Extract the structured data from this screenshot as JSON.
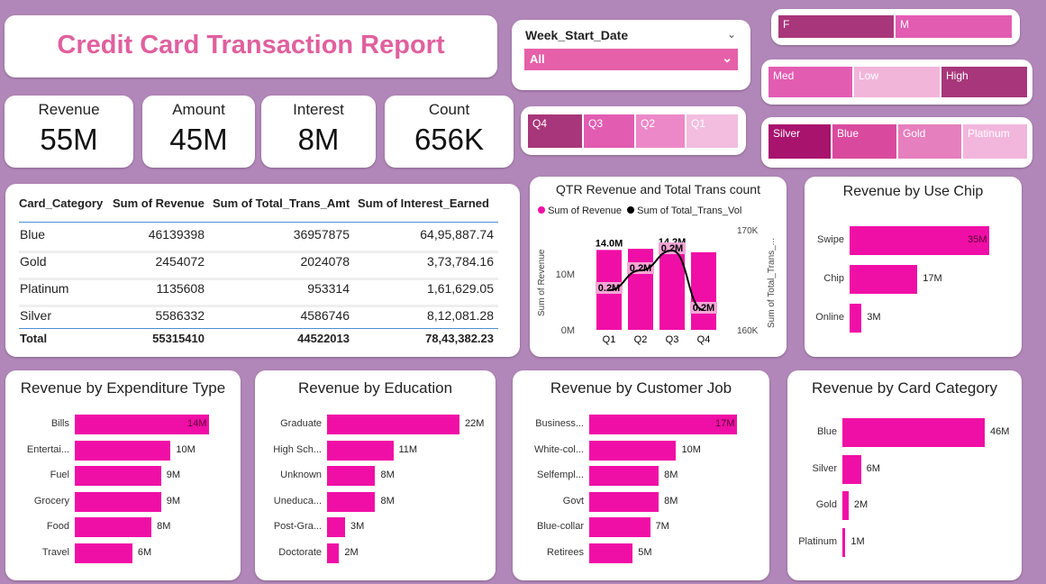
{
  "report_title": "Credit Card Transaction Report",
  "kpis": [
    {
      "label": "Revenue",
      "value": "55M"
    },
    {
      "label": "Amount",
      "value": "45M"
    },
    {
      "label": "Interest",
      "value": "8M"
    },
    {
      "label": "Count",
      "value": "656K"
    }
  ],
  "week_slicer": {
    "label": "Week_Start_Date",
    "selected": "All"
  },
  "gender_slicer": [
    "F",
    "M"
  ],
  "income_slicer": [
    "Med",
    "Low",
    "High"
  ],
  "quarter_slicer": [
    "Q4",
    "Q3",
    "Q2",
    "Q1"
  ],
  "card_slicer": [
    "Silver",
    "Blue",
    "Gold",
    "Platinum"
  ],
  "colors": {
    "accent": "#e0609e",
    "bar": "#f00fa6",
    "background": "#b186b8"
  },
  "table": {
    "headers": [
      "Card_Category",
      "Sum of Revenue",
      "Sum of Total_Trans_Amt",
      "Sum of Interest_Earned"
    ],
    "rows": [
      [
        "Blue",
        "46139398",
        "36957875",
        "64,95,887.74"
      ],
      [
        "Gold",
        "2454072",
        "2024078",
        "3,73,784.16"
      ],
      [
        "Platinum",
        "1135608",
        "953314",
        "1,61,629.05"
      ],
      [
        "Silver",
        "5586332",
        "4586746",
        "8,12,081.28"
      ]
    ],
    "total": [
      "Total",
      "55315410",
      "44522013",
      "78,43,382.23"
    ]
  },
  "qtr_chart": {
    "title": "QTR Revenue and Total Trans count",
    "legend": [
      "Sum of Revenue",
      "Sum of Total_Trans_Vol"
    ],
    "y_left_label": "Sum of Revenue",
    "y_right_label": "Sum of Total_Trans_...",
    "y_left_ticks": [
      "10M",
      "0M"
    ],
    "y_right_ticks": [
      "170K",
      "160K"
    ]
  },
  "chart_data": [
    {
      "type": "bar",
      "title": "QTR Revenue and Total Trans count",
      "categories": [
        "Q1",
        "Q2",
        "Q3",
        "Q4"
      ],
      "series": [
        {
          "name": "Sum of Revenue",
          "values": [
            14.0,
            14.2,
            14.2,
            13.6
          ],
          "labels": [
            "14.0M",
            "",
            "14.2M",
            ""
          ]
        },
        {
          "name": "Sum of Total_Trans_Vol",
          "values": [
            0.164,
            0.166,
            0.168,
            0.162
          ],
          "labels": [
            "0.2M",
            "0.2M",
            "0.2M",
            "0.2M"
          ]
        }
      ],
      "ylim": [
        0,
        15
      ]
    },
    {
      "type": "bar",
      "title": "Revenue by Use Chip",
      "categories": [
        "Swipe",
        "Chip",
        "Online"
      ],
      "values": [
        35,
        17,
        3
      ],
      "labels": [
        "35M",
        "17M",
        "3M"
      ]
    },
    {
      "type": "bar",
      "title": "Revenue by Expenditure Type",
      "categories": [
        "Bills",
        "Entertai...",
        "Fuel",
        "Grocery",
        "Food",
        "Travel"
      ],
      "values": [
        14,
        10,
        9,
        9,
        8,
        6
      ],
      "labels": [
        "14M",
        "10M",
        "9M",
        "9M",
        "8M",
        "6M"
      ]
    },
    {
      "type": "bar",
      "title": "Revenue by Education",
      "categories": [
        "Graduate",
        "High Sch...",
        "Unknown",
        "Uneduca...",
        "Post-Gra...",
        "Doctorate"
      ],
      "values": [
        22,
        11,
        8,
        8,
        3,
        2
      ],
      "labels": [
        "22M",
        "11M",
        "8M",
        "8M",
        "3M",
        "2M"
      ]
    },
    {
      "type": "bar",
      "title": "Revenue by Customer Job",
      "categories": [
        "Business...",
        "White-col...",
        "Selfempl...",
        "Govt",
        "Blue-collar",
        "Retirees"
      ],
      "values": [
        17,
        10,
        8,
        8,
        7,
        5
      ],
      "labels": [
        "17M",
        "10M",
        "8M",
        "8M",
        "7M",
        "5M"
      ]
    },
    {
      "type": "bar",
      "title": "Revenue by Card Category",
      "categories": [
        "Blue",
        "Silver",
        "Gold",
        "Platinum"
      ],
      "values": [
        46,
        6,
        2,
        1
      ],
      "labels": [
        "46M",
        "6M",
        "2M",
        "1M"
      ]
    }
  ]
}
